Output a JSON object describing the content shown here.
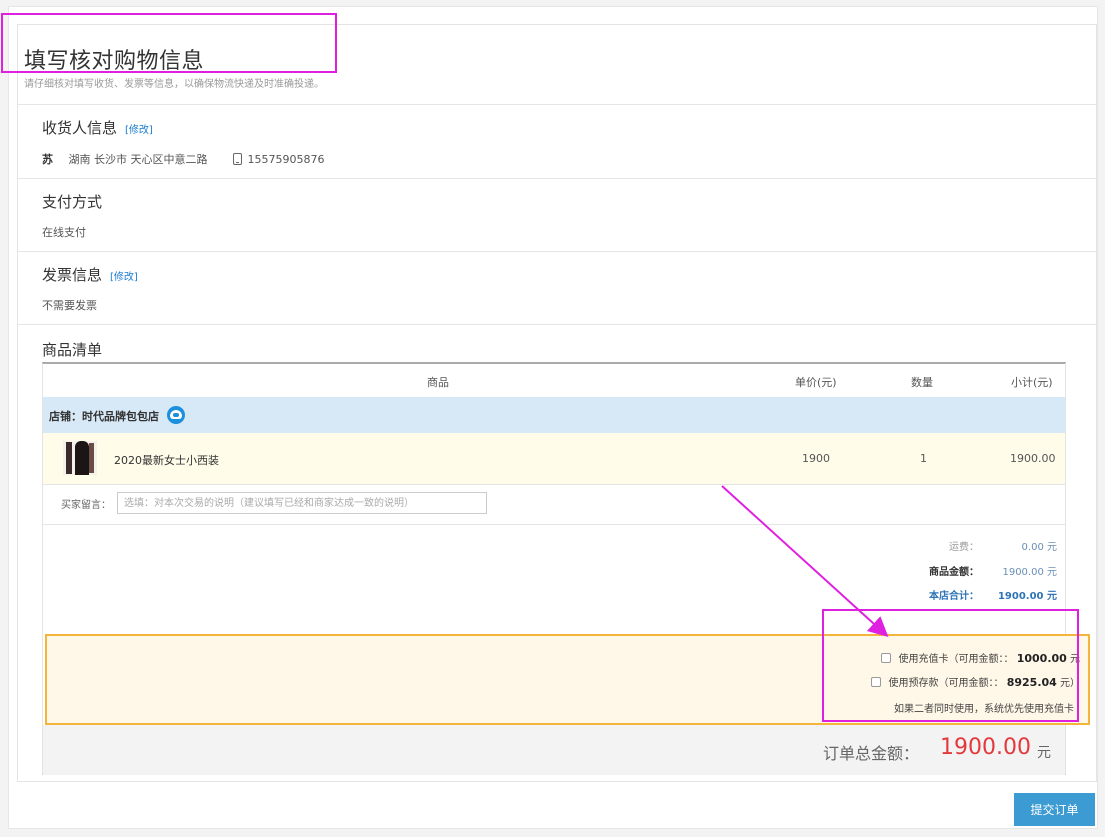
{
  "header": {
    "title": "填写核对购物信息",
    "subtitle": "请仔细核对填写收货、发票等信息，以确保物流快递及时准确投递。"
  },
  "receiver": {
    "title": "收货人信息",
    "modify": "[修改]",
    "name": "苏",
    "address": "湖南 长沙市 天心区中意二路",
    "phone": "15575905876"
  },
  "payment": {
    "title": "支付方式",
    "method": "在线支付"
  },
  "invoice": {
    "title": "发票信息",
    "modify": "[修改]",
    "value": "不需要发票"
  },
  "goods": {
    "title": "商品清单",
    "columns": {
      "product": "商品",
      "unit_price": "单价(元)",
      "quantity": "数量",
      "subtotal": "小计(元)"
    },
    "store_name": "店铺：时代品牌包包店",
    "items": [
      {
        "name": "2020最新女士小西装",
        "price": "1900",
        "qty": "1",
        "subtotal": "1900.00"
      }
    ],
    "message_label": "买家留言：",
    "message_placeholder": "选填：对本次交易的说明（建议填写已经和商家达成一致的说明）"
  },
  "summary": {
    "shipping_label": "运费：",
    "shipping_value": "0.00 元",
    "goods_amount_label": "商品金额：",
    "goods_amount_value": "1900.00 元",
    "store_total_label": "本店合计：",
    "store_total_value": "1900.00 元"
  },
  "balance": {
    "card_label": "使用充值卡（可用金额：：",
    "card_amount": "1000.00",
    "card_unit": "元",
    "deposit_label": "使用预存款（可用金额：：",
    "deposit_amount": "8925.04",
    "deposit_unit": "元）",
    "note": "如果二者同时使用，系统优先使用充值卡"
  },
  "order_total": {
    "label": "订单总金额：",
    "value": "1900.00",
    "unit": "元"
  },
  "submit_label": "提交订单",
  "colors": {
    "accent_blue": "#3c9bd2",
    "price_red": "#e4393c",
    "annotation_magenta": "#e020e0",
    "store_row_bg": "#d7e9f7",
    "pay_box_border": "#f4b53c"
  }
}
